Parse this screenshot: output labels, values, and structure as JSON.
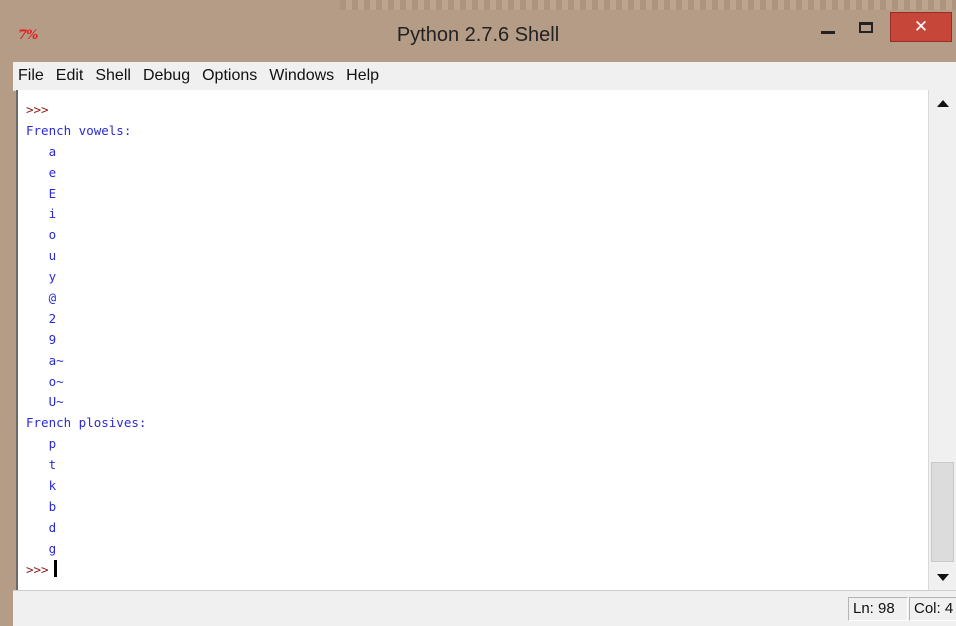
{
  "window": {
    "title": "Python 2.7.6 Shell",
    "app_icon_text": "7%",
    "icons": {
      "app": "idle-tk-icon",
      "minimize": "minimize-icon",
      "maximize": "maximize-icon",
      "close": "close-icon"
    },
    "close_glyph": "✕",
    "colors": {
      "frame": "#b59c86",
      "close": "#c7463a",
      "prompt": "#8b1a1a",
      "output": "#2a2ad8"
    }
  },
  "menubar": {
    "items": [
      "File",
      "Edit",
      "Shell",
      "Debug",
      "Options",
      "Windows",
      "Help"
    ]
  },
  "editor": {
    "lines": [
      {
        "kind": "prompt",
        "text": ">>>"
      },
      {
        "kind": "out",
        "text": "French vowels:"
      },
      {
        "kind": "out",
        "text": "   a"
      },
      {
        "kind": "out",
        "text": "   e"
      },
      {
        "kind": "out",
        "text": "   E"
      },
      {
        "kind": "out",
        "text": "   i"
      },
      {
        "kind": "out",
        "text": "   o"
      },
      {
        "kind": "out",
        "text": "   u"
      },
      {
        "kind": "out",
        "text": "   y"
      },
      {
        "kind": "out",
        "text": "   @"
      },
      {
        "kind": "out",
        "text": "   2"
      },
      {
        "kind": "out",
        "text": "   9"
      },
      {
        "kind": "out",
        "text": "   a~"
      },
      {
        "kind": "out",
        "text": "   o~"
      },
      {
        "kind": "out",
        "text": "   U~"
      },
      {
        "kind": "out",
        "text": "French plosives:"
      },
      {
        "kind": "out",
        "text": "   p"
      },
      {
        "kind": "out",
        "text": "   t"
      },
      {
        "kind": "out",
        "text": "   k"
      },
      {
        "kind": "out",
        "text": "   b"
      },
      {
        "kind": "out",
        "text": "   d"
      },
      {
        "kind": "out",
        "text": "   g"
      },
      {
        "kind": "prompt-caret",
        "text": ">>>"
      }
    ]
  },
  "statusbar": {
    "line": "Ln: 98",
    "col": "Col: 4"
  }
}
